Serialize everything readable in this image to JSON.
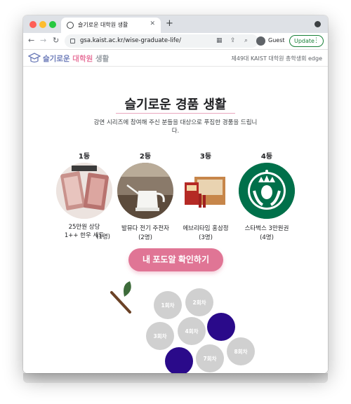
{
  "browser": {
    "tab_title": "슬기로운 대학원 생활",
    "url": "gsa.kaist.ac.kr/wise-graduate-life/",
    "profile_label": "Guest",
    "update_label": "Update"
  },
  "site": {
    "title_part1": "슬기로운",
    "title_part2": "대학원",
    "title_part3": "생활",
    "header_right": "제49대 KAIST 대학원 총학생회 edge"
  },
  "page": {
    "heading": "슬기로운 경품 생활",
    "subtitle": "강연 시리즈에 참여해 주신 분들을 대상으로 푸짐한 경품을 드립니다.",
    "button_label": "내 포도알 확인하기"
  },
  "prizes": [
    {
      "rank": "1등",
      "name": "25만원 상당\n1++ 한우 세트",
      "count": "(1명)"
    },
    {
      "rank": "2등",
      "name": "발뮤다 전기 주전자",
      "count": "(2명)"
    },
    {
      "rank": "3등",
      "name": "에브리타임 홍삼정",
      "count": "(3명)"
    },
    {
      "rank": "4등",
      "name": "스타벅스 3만원권",
      "count": "(4명)"
    }
  ],
  "grapes": [
    {
      "label": "1회차",
      "filled": false
    },
    {
      "label": "2회차",
      "filled": false
    },
    {
      "label": "3회차",
      "filled": false
    },
    {
      "label": "4회차",
      "filled": false
    },
    {
      "label": "",
      "filled": true
    },
    {
      "label": "",
      "filled": true
    },
    {
      "label": "7회차",
      "filled": false
    },
    {
      "label": "8회차",
      "filled": false
    }
  ],
  "colors": {
    "accent_pink": "#e07595",
    "grape_filled": "#2a0a8a",
    "grape_empty": "#d0d0d0"
  }
}
